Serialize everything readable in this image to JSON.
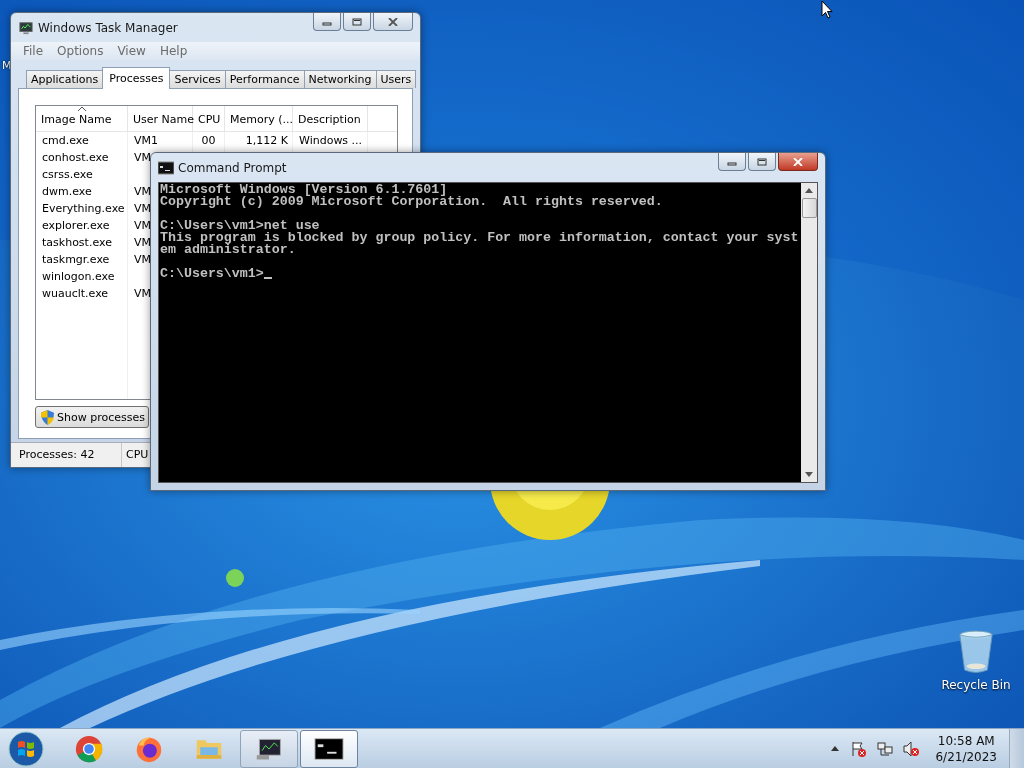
{
  "desktop": {
    "partial_icon_label": "M",
    "recycle_bin": {
      "label": "Recycle Bin"
    }
  },
  "task_manager": {
    "title": "Windows Task Manager",
    "menu": [
      "File",
      "Options",
      "View",
      "Help"
    ],
    "tabs": [
      {
        "label": "Applications",
        "selected": false
      },
      {
        "label": "Processes",
        "selected": true
      },
      {
        "label": "Services",
        "selected": false
      },
      {
        "label": "Performance",
        "selected": false
      },
      {
        "label": "Networking",
        "selected": false
      },
      {
        "label": "Users",
        "selected": false
      }
    ],
    "columns": [
      {
        "label": "Image Name",
        "sorted": true
      },
      {
        "label": "User Name",
        "sorted": false
      },
      {
        "label": "CPU",
        "sorted": false
      },
      {
        "label": "Memory (...",
        "sorted": false
      },
      {
        "label": "Description",
        "sorted": false
      }
    ],
    "rows": [
      {
        "image": "cmd.exe",
        "user": "VM1",
        "cpu": "00",
        "memory": "1,112 K",
        "description": "Windows ..."
      },
      {
        "image": "conhost.exe",
        "user": "VM"
      },
      {
        "image": "csrss.exe"
      },
      {
        "image": "dwm.exe",
        "user": "VM"
      },
      {
        "image": "Everything.exe",
        "user": "VM"
      },
      {
        "image": "explorer.exe",
        "user": "VM"
      },
      {
        "image": "taskhost.exe",
        "user": "VM"
      },
      {
        "image": "taskmgr.exe",
        "user": "VM"
      },
      {
        "image": "winlogon.exe"
      },
      {
        "image": "wuauclt.exe",
        "user": "VM"
      }
    ],
    "button": "Show processes",
    "status_bar": [
      "Processes: 42",
      "CPU"
    ]
  },
  "command_prompt": {
    "title": "Command Prompt",
    "blocks": [
      [
        "Microsoft Windows [Version 6.1.7601]",
        "Copyright (c) 2009 Microsoft Corporation.  All rights reserved."
      ],
      [
        "C:\\Users\\vm1>net use",
        "This program is blocked by group policy. For more information, contact your syst",
        "em administrator."
      ],
      [
        "C:\\Users\\vm1>"
      ]
    ]
  },
  "taskbar": {
    "items": [
      {
        "kind": "chrome",
        "open": false,
        "selected": false
      },
      {
        "kind": "firefox",
        "open": false,
        "selected": false
      },
      {
        "kind": "folder",
        "open": false,
        "selected": false
      },
      {
        "kind": "taskmgr",
        "open": true,
        "selected": false
      },
      {
        "kind": "cmd",
        "open": true,
        "selected": true
      }
    ],
    "clock": {
      "time": "10:58 AM",
      "date": "6/21/2023"
    }
  }
}
